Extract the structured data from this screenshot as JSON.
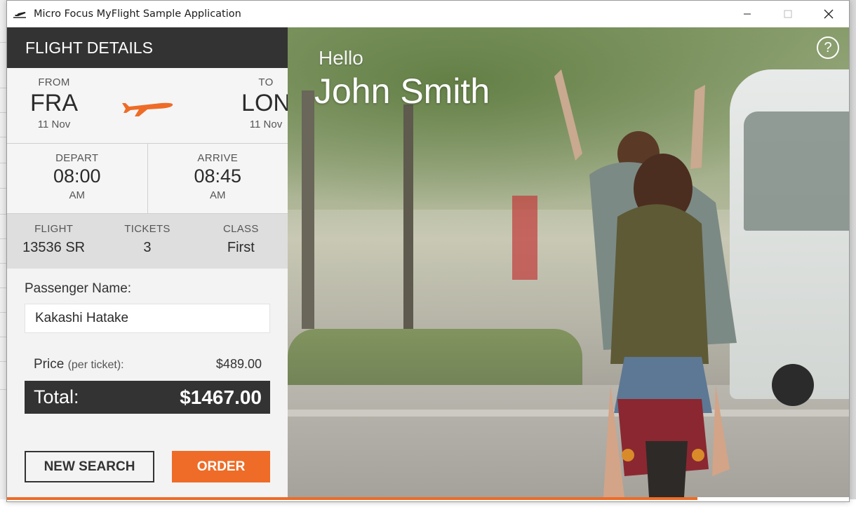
{
  "window": {
    "title": "Micro Focus MyFlight Sample Application",
    "controls": [
      "minimize",
      "maximize",
      "close"
    ]
  },
  "panel": {
    "header": "FLIGHT DETAILS",
    "from": {
      "label": "FROM",
      "code": "FRA",
      "date": "11 Nov"
    },
    "to": {
      "label": "TO",
      "code": "LON",
      "date": "11 Nov"
    },
    "depart": {
      "label": "DEPART",
      "time": "08:00",
      "ampm": "AM"
    },
    "arrive": {
      "label": "ARRIVE",
      "time": "08:45",
      "ampm": "AM"
    },
    "flight": {
      "label": "FLIGHT",
      "value": "13536 SR"
    },
    "tickets": {
      "label": "TICKETS",
      "value": "3"
    },
    "class": {
      "label": "CLASS",
      "value": "First"
    },
    "passenger": {
      "label": "Passenger Name:",
      "value": "Kakashi Hatake"
    },
    "price": {
      "label": "Price",
      "sub": "(per ticket):",
      "value": "$489.00"
    },
    "total": {
      "label": "Total:",
      "value": "$1467.00"
    },
    "buttons": {
      "new_search": "NEW SEARCH",
      "order": "ORDER"
    }
  },
  "hero": {
    "greeting": "Hello",
    "user_name": "John Smith",
    "help": "?"
  },
  "progress": {
    "value": 0.82
  },
  "colors": {
    "accent": "#ee6c27",
    "dark": "#333333"
  }
}
